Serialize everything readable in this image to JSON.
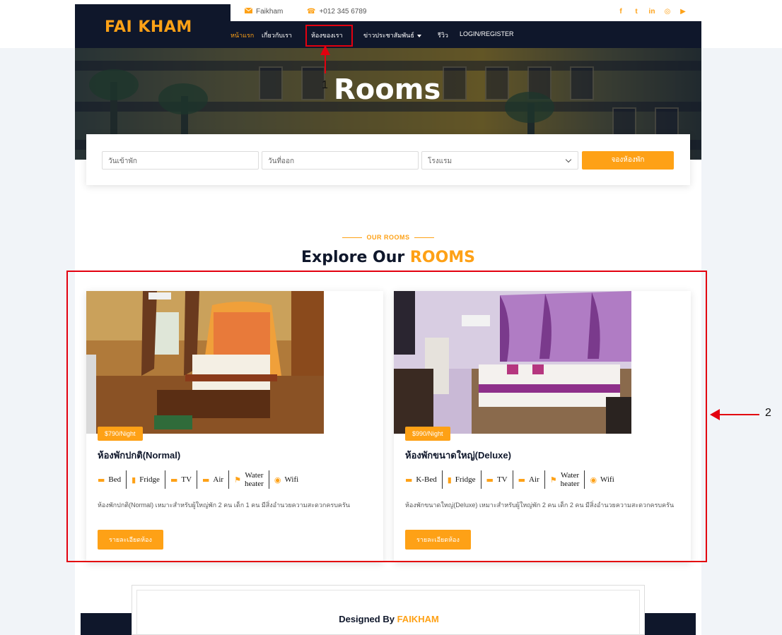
{
  "brand": {
    "name": "FAI KHAM"
  },
  "topbar": {
    "email": "Faikham",
    "phone": "+012 345 6789"
  },
  "social": [
    "facebook-icon",
    "twitter-icon",
    "linkedin-icon",
    "instagram-icon",
    "youtube-icon"
  ],
  "nav": {
    "items": [
      {
        "label": "หน้าแรก",
        "active": true
      },
      {
        "label": "เกี่ยวกับเรา"
      },
      {
        "label": "ห้องของเรา"
      },
      {
        "label": "ข่าวประชาสัมพันธ์",
        "dropdown": true
      },
      {
        "label": "รีวิว"
      },
      {
        "label": "LOGIN/REGISTER"
      }
    ]
  },
  "hero": {
    "title": "Rooms"
  },
  "booking": {
    "checkin_placeholder": "วันเข้าพัก",
    "checkout_placeholder": "วันที่ออก",
    "hotel_placeholder": "โรงแรม",
    "submit_label": "จองห้องพัก"
  },
  "section": {
    "subtitle": "OUR ROOMS",
    "title_main": "Explore Our",
    "title_highlight": "ROOMS"
  },
  "rooms": [
    {
      "price": "$790/Night",
      "title": "ห้องพักปกติ(Normal)",
      "amenities": [
        {
          "icon": "bed-icon",
          "label": "Bed"
        },
        {
          "icon": "fridge-icon",
          "label": "Fridge"
        },
        {
          "icon": "tv-icon",
          "label": "TV"
        },
        {
          "icon": "air-icon",
          "label": "Air"
        },
        {
          "icon": "water-heater-icon",
          "label_line1": "Water",
          "label_line2": "heater"
        },
        {
          "icon": "wifi-icon",
          "label": "Wifi"
        }
      ],
      "description": "ห้องพักปกติ(Normal) เหมาะสำหรับผู้ใหญ่พัก 2 คน เด็ก 1 คน มีสิ่งอำนวยความสะดวกครบครัน",
      "button_label": "รายละเอียดห้อง"
    },
    {
      "price": "$990/Night",
      "title": "ห้องพักขนาดใหญ่(Deluxe)",
      "amenities": [
        {
          "icon": "bed-icon",
          "label": "K-Bed"
        },
        {
          "icon": "fridge-icon",
          "label": "Fridge"
        },
        {
          "icon": "tv-icon",
          "label": "TV"
        },
        {
          "icon": "air-icon",
          "label": "Air"
        },
        {
          "icon": "water-heater-icon",
          "label_line1": "Water",
          "label_line2": "heater"
        },
        {
          "icon": "wifi-icon",
          "label": "Wifi"
        }
      ],
      "description": "ห้องพักขนาดใหญ่(Deluxe) เหมาะสำหรับผู้ใหญ่พัก 2 คน เด็ก 2 คน มีสิ่งอำนวยความสะดวกครบครัน",
      "button_label": "รายละเอียดห้อง"
    }
  ],
  "footer": {
    "designed_prefix": "Designed By",
    "designed_brand": "FAIKHAM"
  },
  "annotations": {
    "label_1": "1",
    "label_2": "2"
  },
  "colors": {
    "accent": "#fea116",
    "dark": "#0f172b",
    "annotation": "#e3000f"
  }
}
